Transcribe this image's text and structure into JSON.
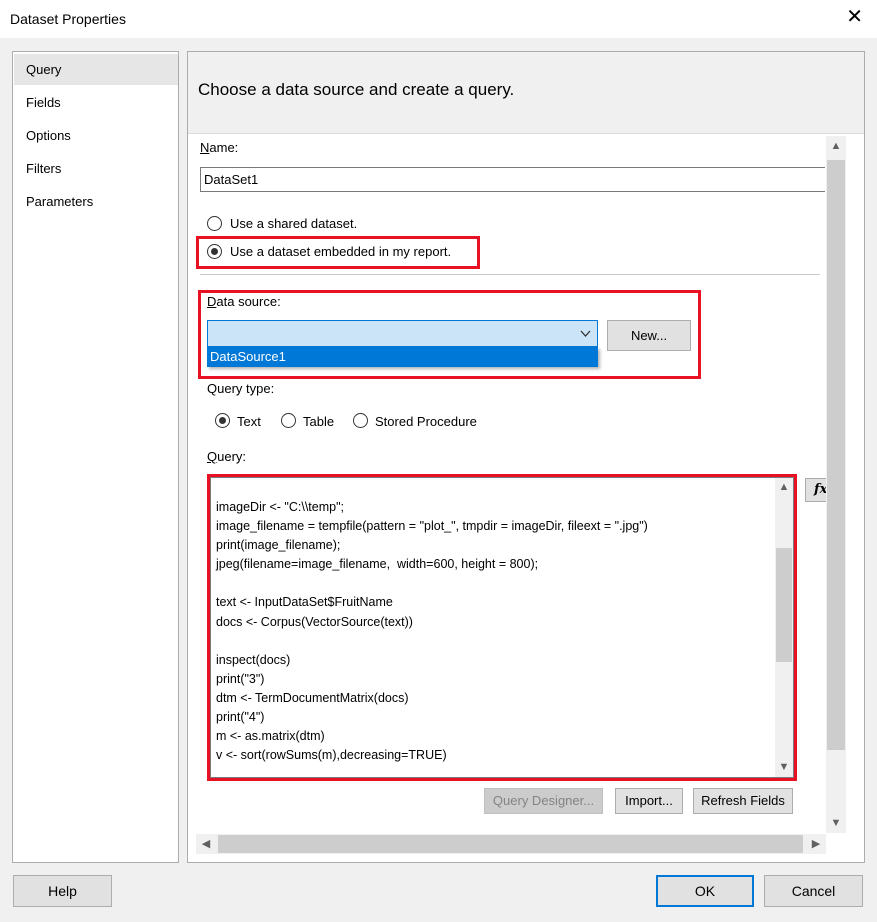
{
  "window": {
    "title": "Dataset Properties",
    "close_glyph": "✕"
  },
  "sidebar": {
    "items": [
      {
        "label": "Query",
        "selected": true
      },
      {
        "label": "Fields",
        "selected": false
      },
      {
        "label": "Options",
        "selected": false
      },
      {
        "label": "Filters",
        "selected": false
      },
      {
        "label": "Parameters",
        "selected": false
      }
    ]
  },
  "header": {
    "text": "Choose a data source and create a query."
  },
  "form": {
    "name_label": "Name:",
    "name_value": "DataSet1",
    "radio_shared": "Use a shared dataset.",
    "radio_embedded": "Use a dataset embedded in my report.",
    "data_source_label": "Data source:",
    "data_source_value": "",
    "data_source_option": "DataSource1",
    "new_button": "New...",
    "query_type_label": "Query type:",
    "query_type_text": "Text",
    "query_type_table": "Table",
    "query_type_stored": "Stored Procedure",
    "query_label": "Query:",
    "query_lines": [
      "imageDir <- \"C:\\\\temp\";",
      "image_filename = tempfile(pattern = \"plot_\", tmpdir = imageDir, fileext = \".jpg\")",
      "print(image_filename);",
      "jpeg(filename=image_filename,  width=600, height = 800);",
      "",
      "text <- InputDataSet$FruitName",
      "docs <- Corpus(VectorSource(text))",
      "",
      "inspect(docs)",
      "print(\"3\")",
      "dtm <- TermDocumentMatrix(docs)",
      "print(\"4\")",
      "m <- as.matrix(dtm)",
      "v <- sort(rowSums(m),decreasing=TRUE)"
    ],
    "fx_button": "fx",
    "query_designer_button": "Query Designer...",
    "import_button": "Import...",
    "refresh_fields_button": "Refresh Fields"
  },
  "footer": {
    "help_button": "Help",
    "ok_button": "OK",
    "cancel_button": "Cancel"
  },
  "colors": {
    "highlight_red": "#e81123",
    "selection_blue": "#0078d7"
  }
}
